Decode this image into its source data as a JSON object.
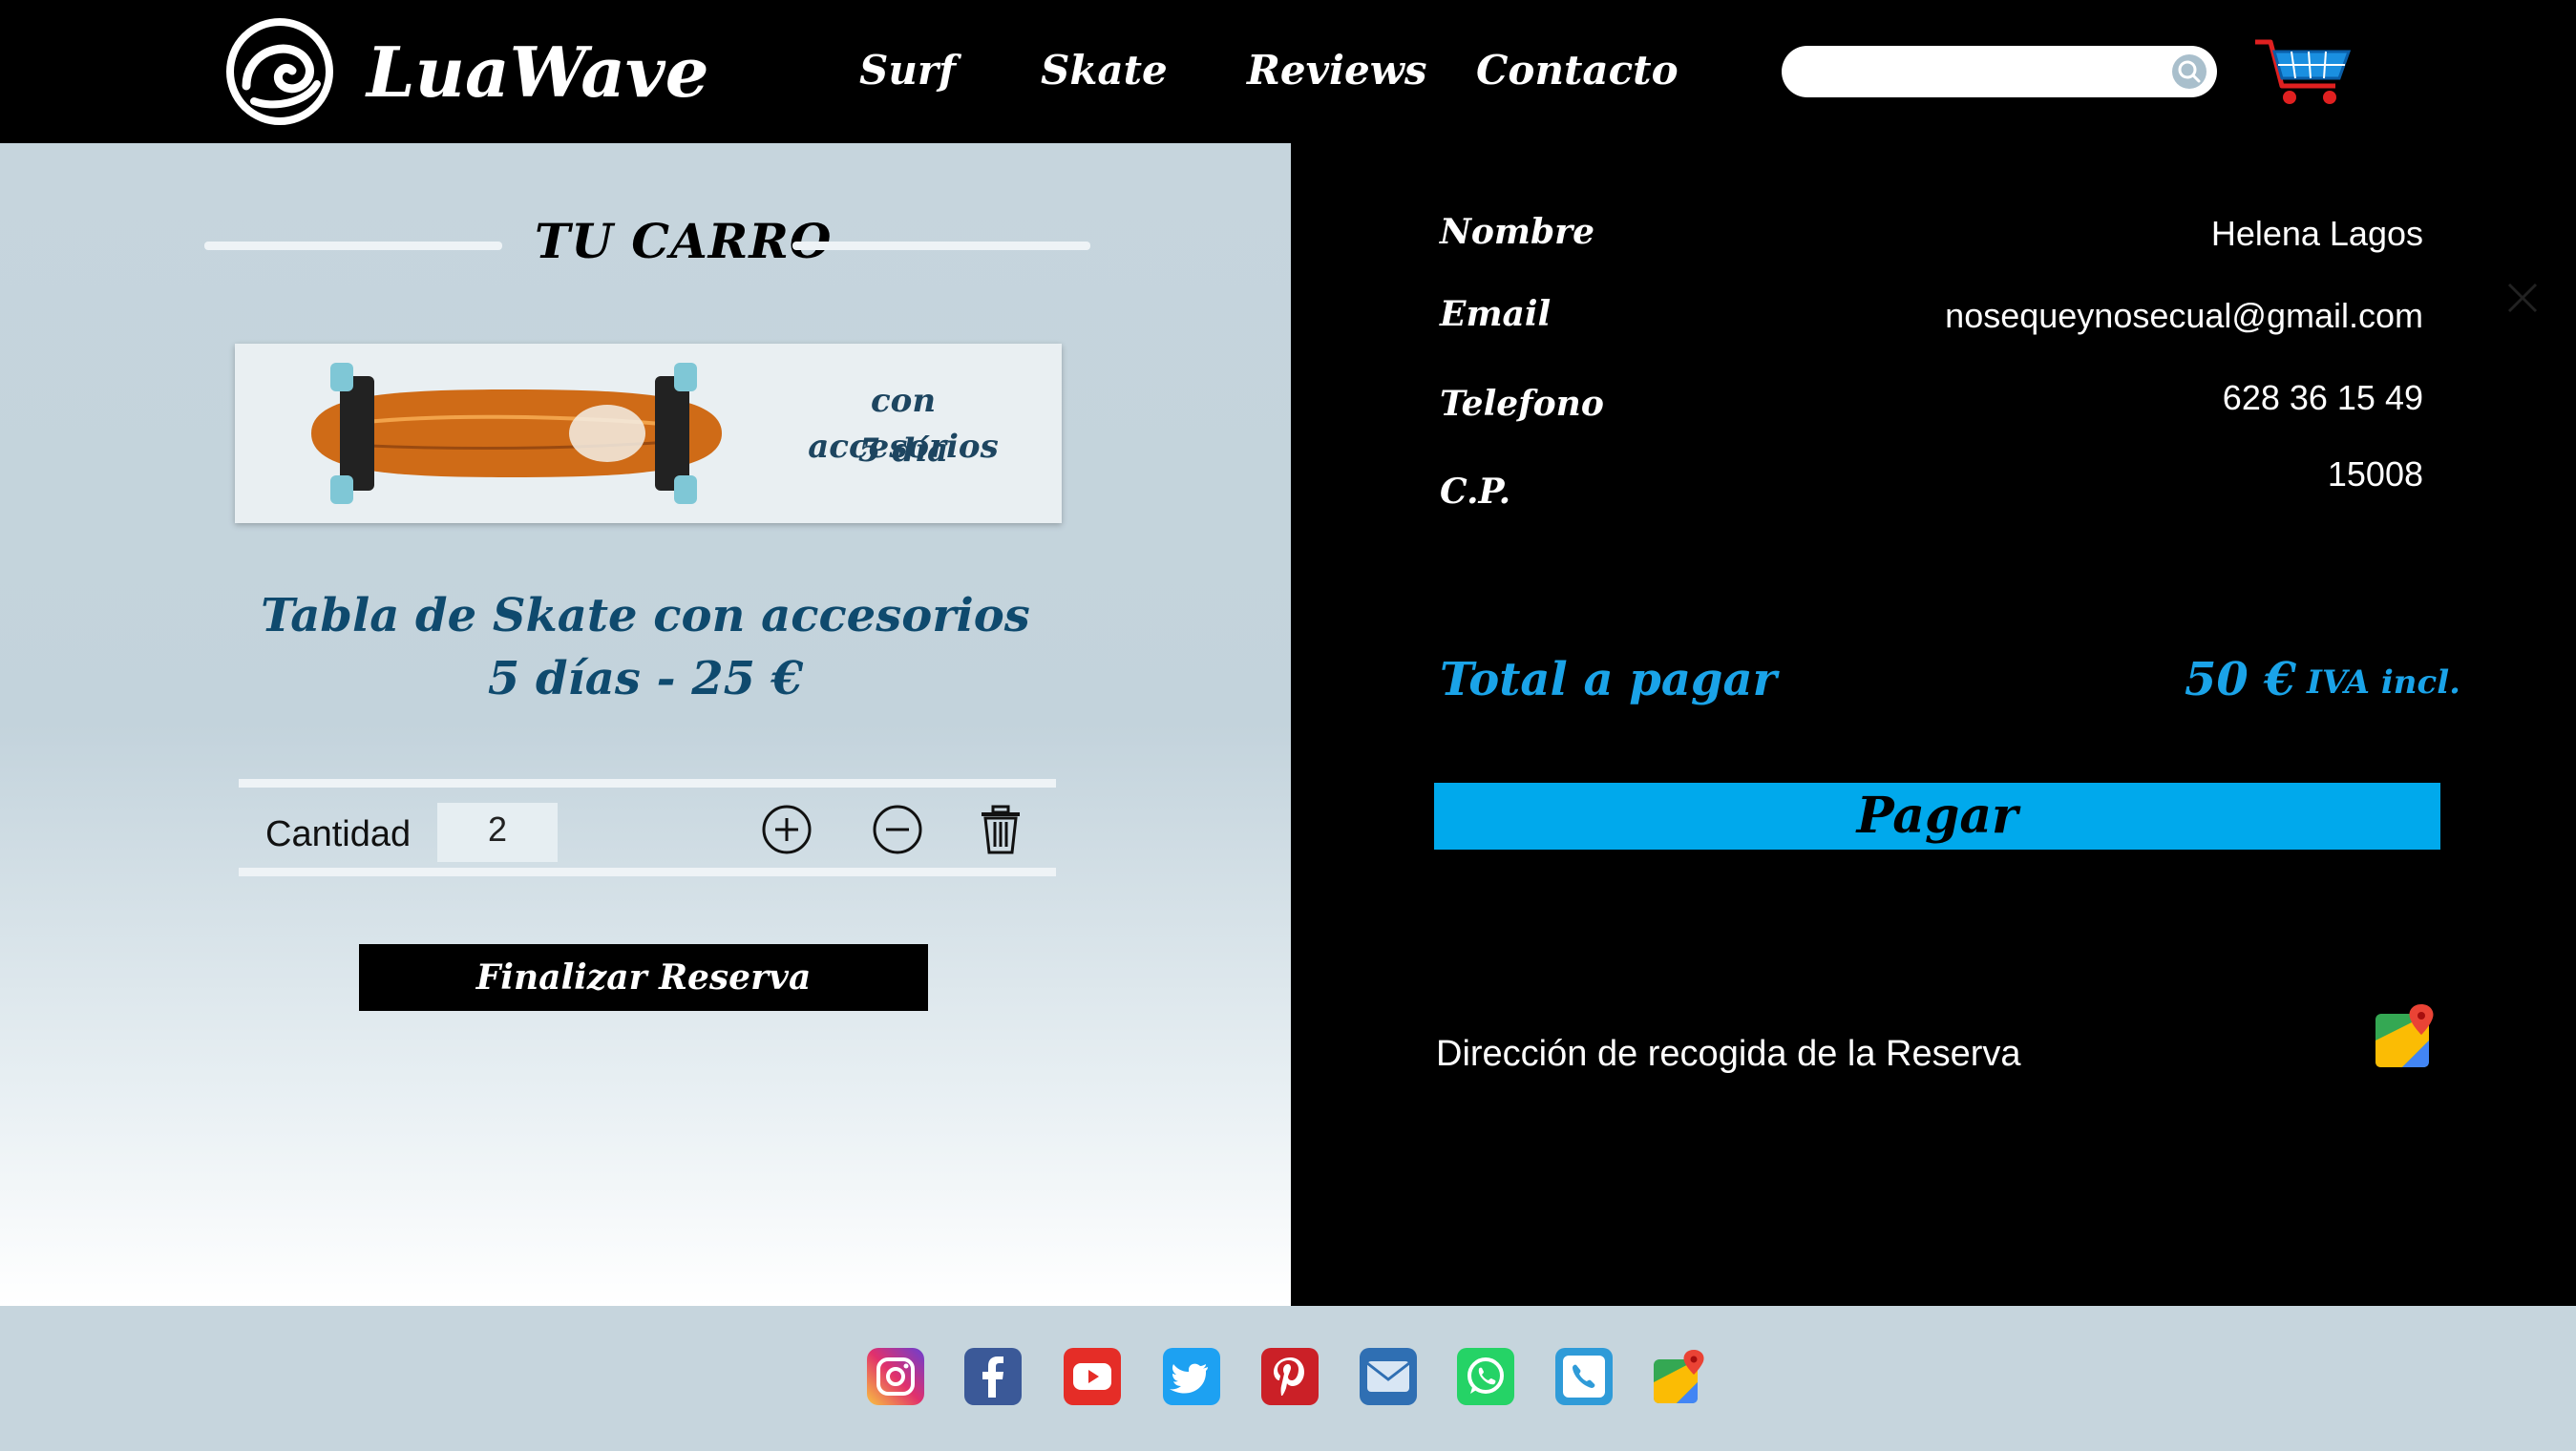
{
  "header": {
    "brand": "LuaWave",
    "nav": [
      "Surf",
      "Skate",
      "Reviews",
      "Contacto"
    ],
    "search_value": ""
  },
  "cart": {
    "title": "TU CARRO",
    "card_line1": "con accesorios",
    "card_line2": "5 día",
    "product_line1": "Tabla de Skate con accesorios",
    "product_line2": "5 días - 25 €",
    "quantity_label": "Cantidad",
    "quantity_value": "2",
    "finalize_label": "Finalizar Reserva"
  },
  "checkout": {
    "fields": [
      {
        "label": "Nombre",
        "value": "Helena Lagos"
      },
      {
        "label": "Email",
        "value": "nosequeynosecual@gmail.com"
      },
      {
        "label": "Telefono",
        "value": "628 36 15 49"
      },
      {
        "label": "C.P.",
        "value": "15008"
      }
    ],
    "total_label": "Total a pagar",
    "total_amount": "50 €",
    "total_tax": "IVA incl.",
    "pay_label": "Pagar",
    "pickup_label": "Dirección de recogida de la Reserva"
  },
  "colors": {
    "accent": "#00a9ec",
    "total_text": "#1aa3e8",
    "product_text": "#0f4a6e",
    "header_bg": "#000000",
    "panel_bg": "#c6d5dd"
  },
  "footer": {
    "icons": [
      "instagram-icon",
      "facebook-icon",
      "youtube-icon",
      "twitter-icon",
      "pinterest-icon",
      "mail-icon",
      "whatsapp-icon",
      "phone-icon",
      "maps-icon"
    ]
  }
}
